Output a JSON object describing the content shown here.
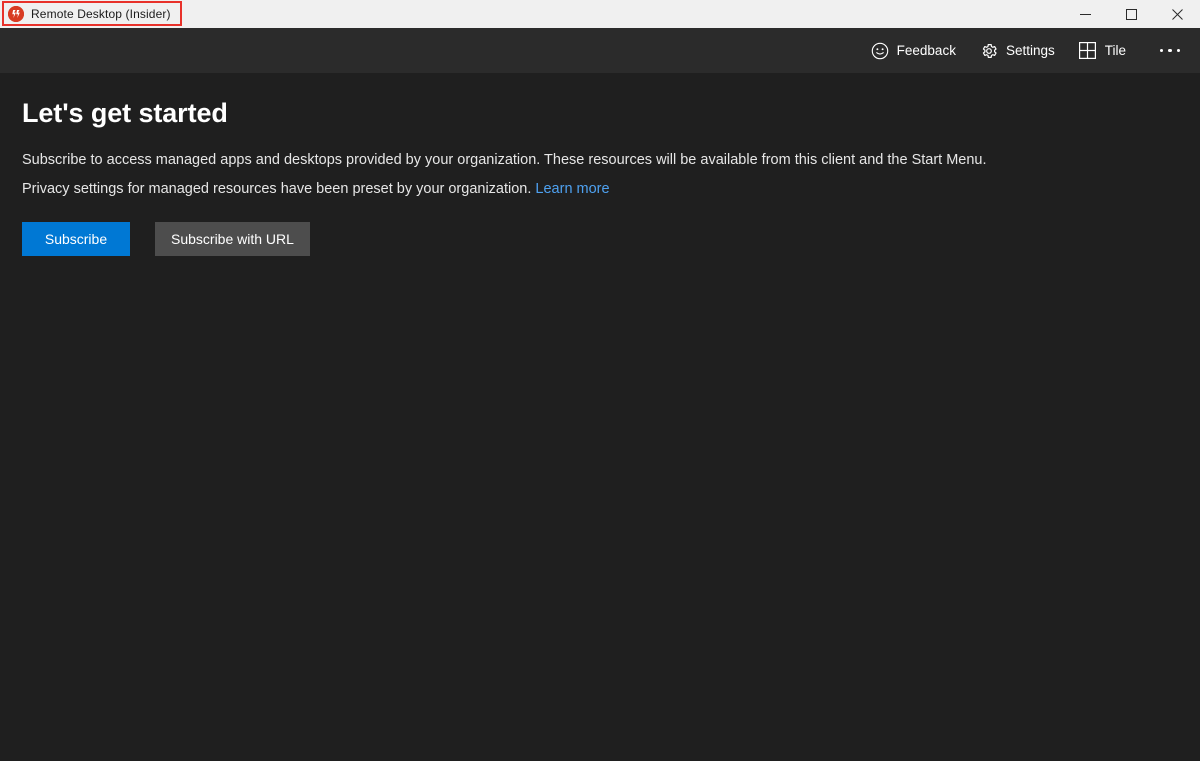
{
  "window": {
    "title": "Remote Desktop (Insider)",
    "app_icon": "remote-desktop-insider-icon",
    "controls": {
      "minimize": "minimize-icon",
      "maximize": "maximize-icon",
      "close": "close-icon"
    },
    "annotation": {
      "present": true,
      "color": "#e8312a",
      "targets": "title-bar-app-title"
    }
  },
  "toolbar": {
    "items": [
      {
        "label": "Feedback",
        "icon": "smiley-face-icon"
      },
      {
        "label": "Settings",
        "icon": "gear-icon"
      },
      {
        "label": "Tile",
        "icon": "grid-tile-icon"
      }
    ],
    "overflow": "more-options-icon"
  },
  "main": {
    "heading": "Let's get started",
    "paragraph_1": "Subscribe to access managed apps and desktops provided by your organization. These resources will be available from this client and the Start Menu.",
    "paragraph_2_text": "Privacy settings for managed resources have been preset by your organization.",
    "paragraph_2_link": "Learn more",
    "buttons": {
      "primary": "Subscribe",
      "secondary": "Subscribe with URL"
    }
  },
  "colors": {
    "titlebar_bg": "#f0f0f0",
    "toolbar_bg": "#2b2b2b",
    "content_bg": "#1f1f1f",
    "accent": "#0078d4",
    "link": "#4ea1f0",
    "secondary_button": "#4d4d4d",
    "annotation": "#e8312a",
    "app_icon": "#d83b22"
  }
}
